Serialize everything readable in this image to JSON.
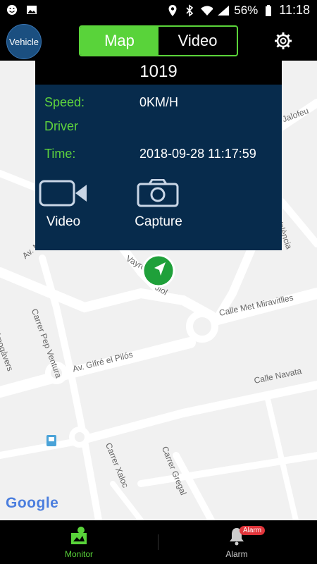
{
  "status_bar": {
    "battery_percent": "56%",
    "time": "11:18",
    "icons": [
      "smiley-icon",
      "image-icon",
      "location-icon",
      "bluetooth-icon",
      "wifi-icon",
      "signal-icon",
      "battery-icon"
    ]
  },
  "header": {
    "vehicle_label": "Vehicle",
    "tabs": [
      {
        "label": "Map",
        "active": true
      },
      {
        "label": "Video",
        "active": false
      }
    ],
    "settings_icon": "gear-icon"
  },
  "popup": {
    "vehicle_id": "1019",
    "speed_label": "Speed:",
    "speed_value": "0KM/H",
    "driver_label": "Driver",
    "time_label": "Time:",
    "time_value": "2018-09-28 11:17:59",
    "actions": [
      {
        "label": "Video",
        "icon": "video-camera-icon"
      },
      {
        "label": "Capture",
        "icon": "camera-icon"
      }
    ]
  },
  "map": {
    "marker_label": "1019",
    "streets": [
      "Calle Met Miravitlles",
      "Carrer Pep Ventura",
      "Av. Gifré el Pilós",
      "Calle Navata",
      "Carrer Xaloc",
      "Carrer Gregal",
      "Almogàvers",
      "València",
      "Jalofeu",
      "Av. M",
      "Vayre",
      "Jiol"
    ],
    "google_logo": "Google",
    "accent_color": "#59d33a",
    "marker_color": "#1fa03a"
  },
  "bottom_nav": {
    "items": [
      {
        "label": "Monitor",
        "icon": "monitor-icon",
        "active": true
      },
      {
        "label": "Alarm",
        "icon": "bell-icon",
        "active": false
      }
    ],
    "alarm_badge": "Alarm"
  }
}
